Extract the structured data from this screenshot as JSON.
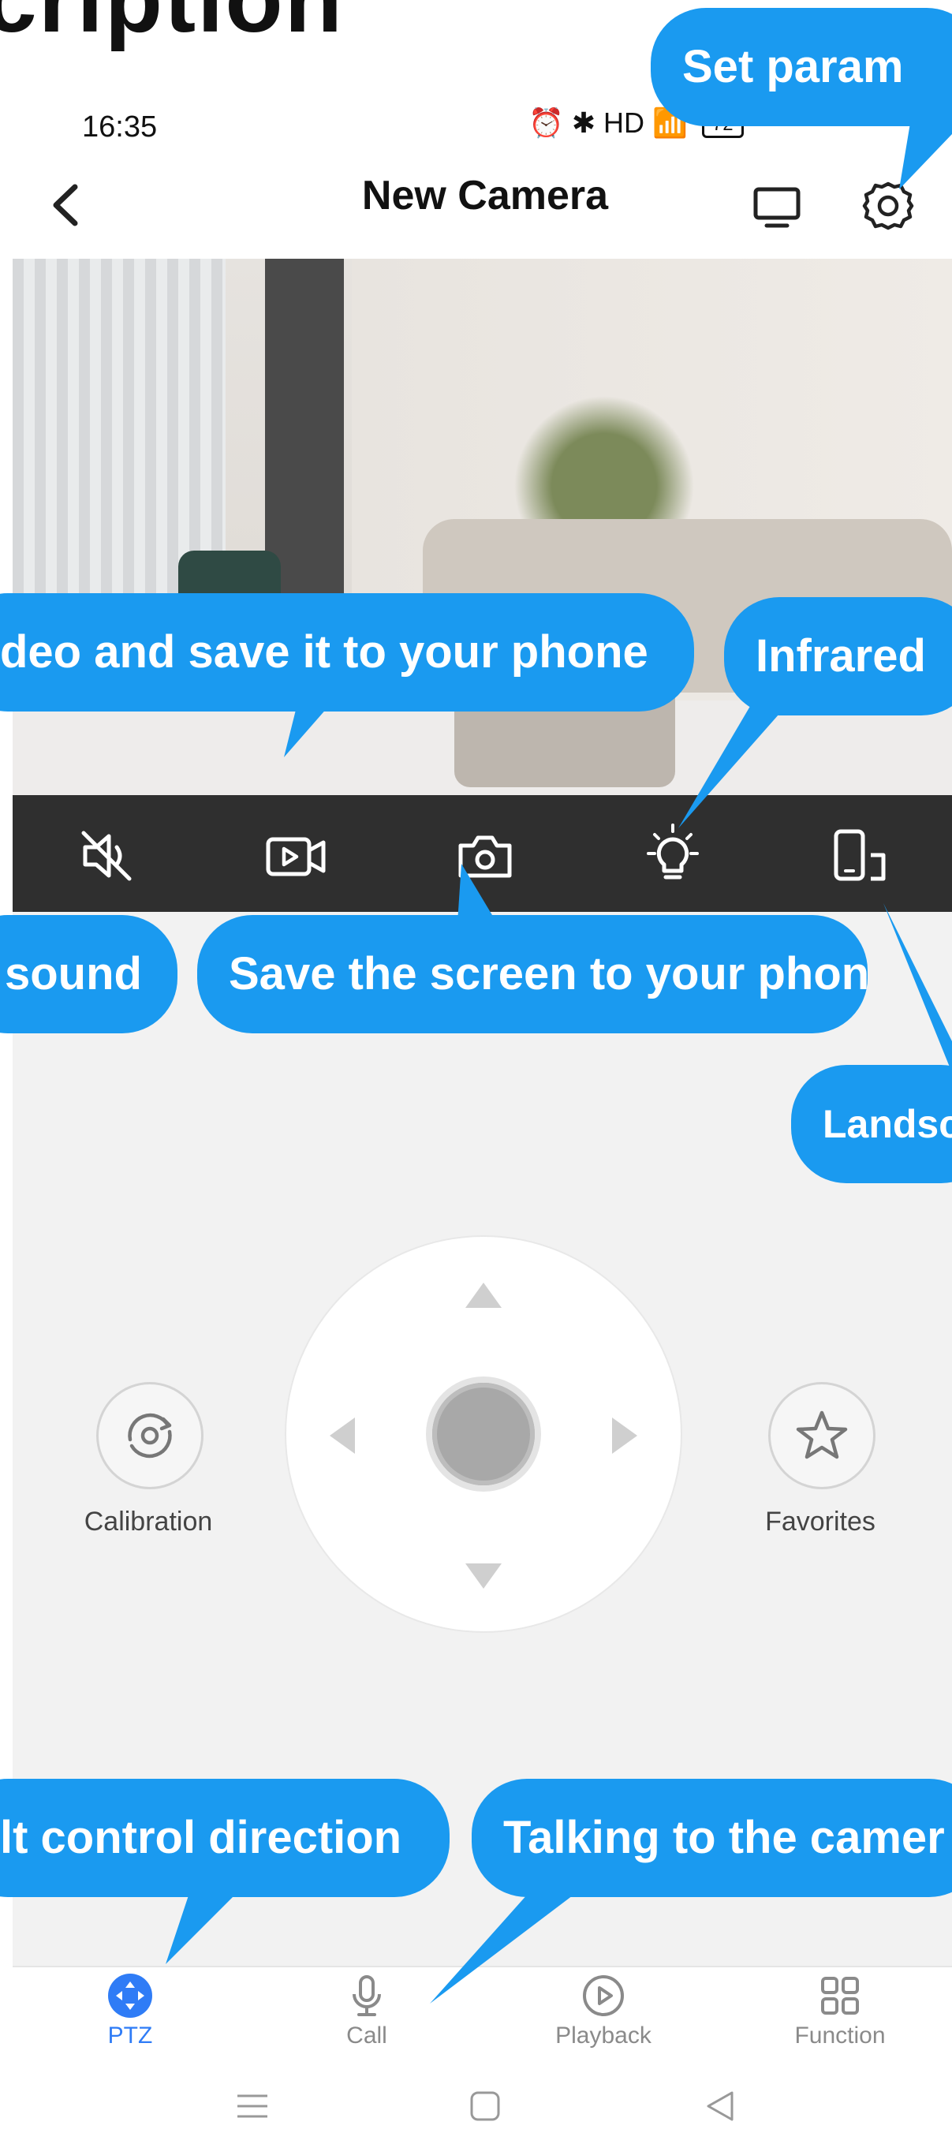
{
  "banner": {
    "title": "cription"
  },
  "status_bar": {
    "time": "16:35",
    "icons": "⏰ ✱ HD 📶",
    "battery": "72"
  },
  "header": {
    "title": "New Camera"
  },
  "callouts": {
    "set_params": "Set param",
    "record_video": "deo and save it to your phone",
    "infrared": "Infrared",
    "sound": "sound",
    "screenshot": "Save the screen to your phone",
    "landscape": "Landsca",
    "control_direction": "lt control direction",
    "talking": "Talking to the camer"
  },
  "ptz": {
    "calibration_label": "Calibration",
    "favorites_label": "Favorites"
  },
  "bottom_nav": {
    "items": [
      {
        "label": "PTZ",
        "active": true
      },
      {
        "label": "Call",
        "active": false
      },
      {
        "label": "Playback",
        "active": false
      },
      {
        "label": "Function",
        "active": false
      }
    ]
  },
  "colors": {
    "callout_blue": "#1a9af0",
    "active_blue": "#2f7cf6",
    "control_bar": "#2f2f2f"
  }
}
